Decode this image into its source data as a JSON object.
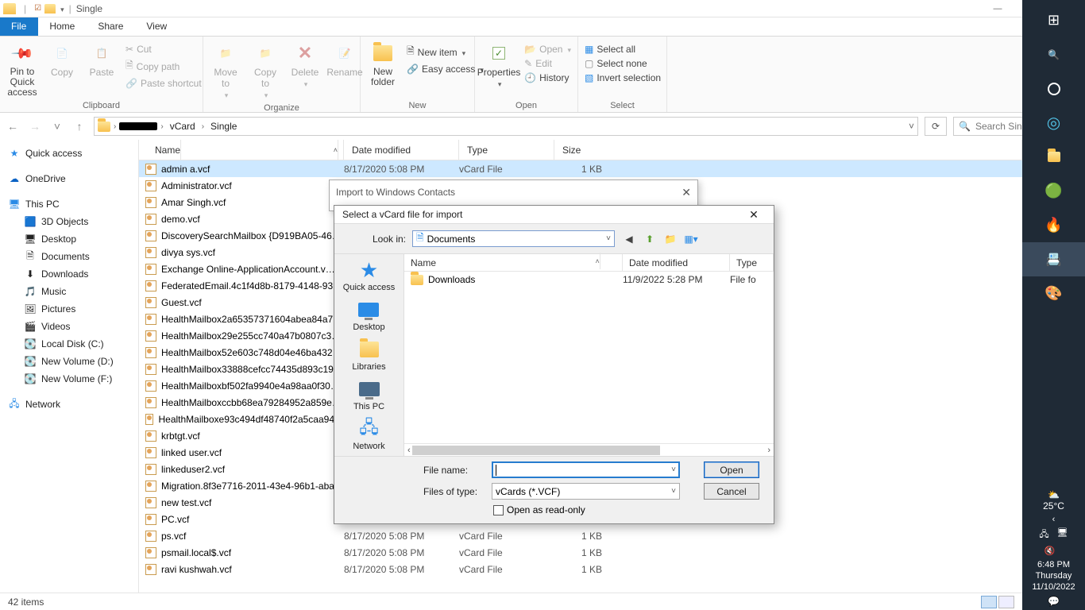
{
  "window": {
    "title": "Single"
  },
  "tabs": {
    "file": "File",
    "home": "Home",
    "share": "Share",
    "view": "View"
  },
  "ribbon": {
    "pin": "Pin to Quick access",
    "copy": "Copy",
    "paste": "Paste",
    "cut": "Cut",
    "copypath": "Copy path",
    "pasteshort": "Paste shortcut",
    "clipboard": "Clipboard",
    "moveto": "Move to",
    "copyto": "Copy to",
    "delete": "Delete",
    "rename": "Rename",
    "organize": "Organize",
    "newfolder": "New folder",
    "newitem": "New item",
    "easyaccess": "Easy access",
    "new": "New",
    "properties": "Properties",
    "open": "Open",
    "edit": "Edit",
    "history": "History",
    "opengrp": "Open",
    "selectall": "Select all",
    "selectnone": "Select none",
    "invert": "Invert selection",
    "select": "Select"
  },
  "breadcrumb": {
    "parts": [
      "vCard",
      "Single"
    ]
  },
  "search": {
    "placeholder": "Search Single"
  },
  "columns": {
    "name": "Name",
    "date": "Date modified",
    "type": "Type",
    "size": "Size"
  },
  "sidebar": {
    "quick": "Quick access",
    "onedrive": "OneDrive",
    "thispc": "This PC",
    "pcitems": [
      "3D Objects",
      "Desktop",
      "Documents",
      "Downloads",
      "Music",
      "Pictures",
      "Videos",
      "Local Disk (C:)",
      "New Volume (D:)",
      "New Volume (F:)"
    ],
    "network": "Network"
  },
  "files": [
    {
      "name": "admin a.vcf",
      "date": "8/17/2020 5:08 PM",
      "type": "vCard File",
      "size": "1 KB",
      "sel": true
    },
    {
      "name": "Administrator.vcf",
      "date": "",
      "type": "",
      "size": ""
    },
    {
      "name": "Amar Singh.vcf",
      "date": "",
      "type": "",
      "size": ""
    },
    {
      "name": "demo.vcf",
      "date": "",
      "type": "",
      "size": ""
    },
    {
      "name": "DiscoverySearchMailbox {D919BA05-46…",
      "date": "",
      "type": "",
      "size": ""
    },
    {
      "name": "divya sys.vcf",
      "date": "",
      "type": "",
      "size": ""
    },
    {
      "name": "Exchange Online-ApplicationAccount.v…",
      "date": "",
      "type": "",
      "size": ""
    },
    {
      "name": "FederatedEmail.4c1f4d8b-8179-4148-93…",
      "date": "",
      "type": "",
      "size": ""
    },
    {
      "name": "Guest.vcf",
      "date": "",
      "type": "",
      "size": ""
    },
    {
      "name": "HealthMailbox2a65357371604abea84a7…",
      "date": "",
      "type": "",
      "size": ""
    },
    {
      "name": "HealthMailbox29e255cc740a47b0807c3…",
      "date": "",
      "type": "",
      "size": ""
    },
    {
      "name": "HealthMailbox52e603c748d04e46ba432…",
      "date": "",
      "type": "",
      "size": ""
    },
    {
      "name": "HealthMailbox33888cefcc74435d893c19…",
      "date": "",
      "type": "",
      "size": ""
    },
    {
      "name": "HealthMailboxbf502fa9940e4a98aa0f30…",
      "date": "",
      "type": "",
      "size": ""
    },
    {
      "name": "HealthMailboxccbb68ea79284952a859e…",
      "date": "",
      "type": "",
      "size": ""
    },
    {
      "name": "HealthMailboxe93c494df48740f2a5caa94…",
      "date": "",
      "type": "",
      "size": ""
    },
    {
      "name": "krbtgt.vcf",
      "date": "",
      "type": "",
      "size": ""
    },
    {
      "name": "linked user.vcf",
      "date": "",
      "type": "",
      "size": ""
    },
    {
      "name": "linkeduser2.vcf",
      "date": "",
      "type": "",
      "size": ""
    },
    {
      "name": "Migration.8f3e7716-2011-43e4-96b1-aba…",
      "date": "",
      "type": "",
      "size": ""
    },
    {
      "name": "new test.vcf",
      "date": "",
      "type": "",
      "size": ""
    },
    {
      "name": "PC.vcf",
      "date": "",
      "type": "",
      "size": ""
    },
    {
      "name": "ps.vcf",
      "date": "8/17/2020 5:08 PM",
      "type": "vCard File",
      "size": "1 KB"
    },
    {
      "name": "psmail.local$.vcf",
      "date": "8/17/2020 5:08 PM",
      "type": "vCard File",
      "size": "1 KB"
    },
    {
      "name": "ravi kushwah.vcf",
      "date": "8/17/2020 5:08 PM",
      "type": "vCard File",
      "size": "1 KB"
    }
  ],
  "status": {
    "count": "42 items"
  },
  "backdlg": {
    "title": "Import to Windows Contacts"
  },
  "dlg": {
    "title": "Select a vCard file for import",
    "lookin_lbl": "Look in:",
    "lookin_val": "Documents",
    "columns": {
      "name": "Name",
      "date": "Date modified",
      "type": "Type"
    },
    "rows": [
      {
        "name": "Downloads",
        "date": "11/9/2022 5:28 PM",
        "type": "File fo"
      }
    ],
    "places": {
      "quick": "Quick access",
      "desktop": "Desktop",
      "libraries": "Libraries",
      "thispc": "This PC",
      "network": "Network"
    },
    "filename_lbl": "File name:",
    "filename_val": "",
    "filetype_lbl": "Files of type:",
    "filetype_val": "vCards (*.VCF)",
    "readonly": "Open as read-only",
    "open": "Open",
    "cancel": "Cancel"
  },
  "taskbar": {
    "temp": "25°C",
    "clock": {
      "time": "6:48 PM",
      "day": "Thursday",
      "date": "11/10/2022"
    }
  }
}
